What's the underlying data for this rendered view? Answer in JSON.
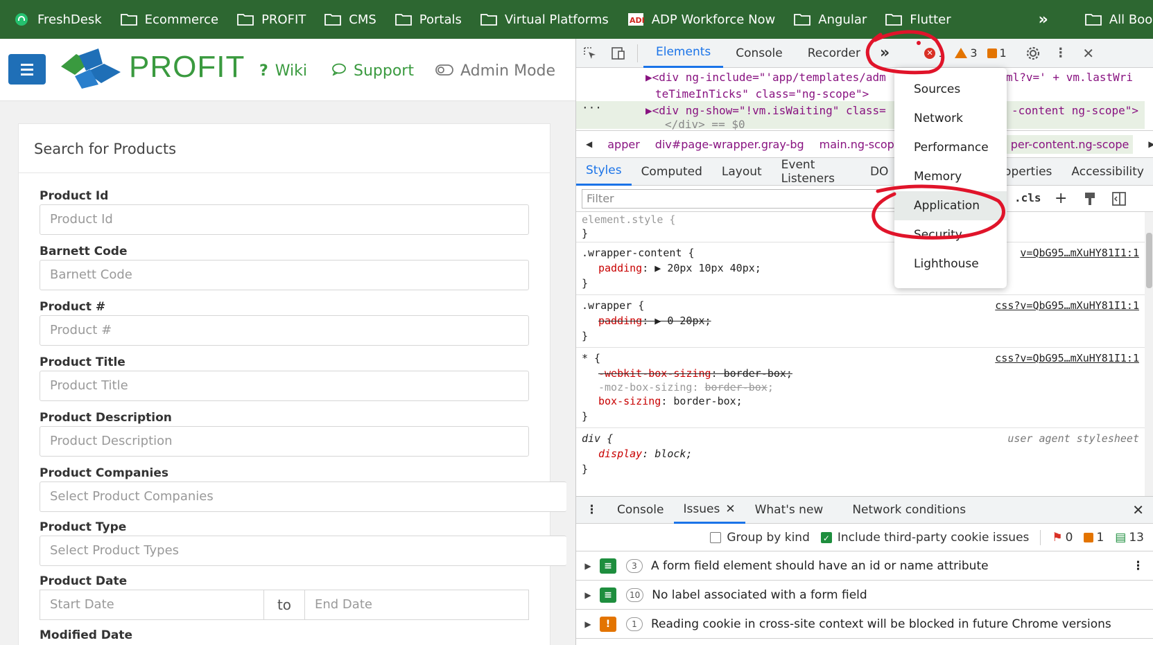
{
  "bookmarks": [
    {
      "label": "FreshDesk",
      "icon": "freshdesk-icon"
    },
    {
      "label": "Ecommerce",
      "icon": "folder-icon"
    },
    {
      "label": "PROFIT",
      "icon": "folder-icon"
    },
    {
      "label": "CMS",
      "icon": "folder-icon"
    },
    {
      "label": "Portals",
      "icon": "folder-icon"
    },
    {
      "label": "Virtual Platforms",
      "icon": "folder-icon"
    },
    {
      "label": "ADP Workforce Now",
      "icon": "adp-icon"
    },
    {
      "label": "Angular",
      "icon": "folder-icon"
    },
    {
      "label": "Flutter",
      "icon": "folder-icon"
    }
  ],
  "bookmarks_more": "»",
  "all_bookmarks": "All Bookmarks",
  "app": {
    "logo_text": "PROFIT",
    "nav": {
      "wiki": "Wiki",
      "support": "Support",
      "admin": "Admin Mode"
    },
    "brand_green": "#3a9a3f",
    "menu_blue": "#1f6fb7"
  },
  "search": {
    "title": "Search for Products",
    "fields": [
      {
        "label": "Product Id",
        "placeholder": "Product Id"
      },
      {
        "label": "Barnett Code",
        "placeholder": "Barnett Code"
      },
      {
        "label": "Product #",
        "placeholder": "Product #"
      },
      {
        "label": "Product Title",
        "placeholder": "Product Title"
      },
      {
        "label": "Product Description",
        "placeholder": "Product Description"
      },
      {
        "label": "Product Companies",
        "placeholder": "Select Product Companies"
      },
      {
        "label": "Product Type",
        "placeholder": "Select Product Types"
      }
    ],
    "date": {
      "label": "Product Date",
      "start": "Start Date",
      "to": "to",
      "end": "End Date"
    },
    "modified_label": "Modified Date"
  },
  "devtools": {
    "tabs": [
      "Elements",
      "Console",
      "Recorder"
    ],
    "active_tab": "Elements",
    "more_tabs": "»",
    "counts": {
      "errors": "1",
      "warnings": "3",
      "issues": "1"
    },
    "dom": {
      "line1a": "▶<div ng-include=\"'app/templates/adm",
      "line1b": "ml?v=' + vm.lastWri",
      "line2": "teTimeInTicks\" class=\"ng-scope\">",
      "line3a": "▶<div ng-show=\"!vm.isWaiting\" class=",
      "line3b": "-content ng-scope\">",
      "line4": "</div> == $0",
      "ellipsis": "···"
    },
    "breadcrumbs": [
      "apper",
      "div#page-wrapper.gray-bg",
      "main.ng-scope",
      "per-content.ng-scope"
    ],
    "sub_tabs": [
      "Styles",
      "Computed",
      "Layout",
      "Event Listeners",
      "DO",
      "roperties",
      "Accessibility"
    ],
    "filter_placeholder": "Filter",
    "cls": ".cls",
    "rules": {
      "element_style": "element.style {",
      "close": "}",
      "wc_selector": ".wrapper-content {",
      "wc_prop": "padding",
      "wc_value": "▶ 20px 10px 40px;",
      "wc_src": "v=QbG95…mXuHY81I1:1",
      "w_selector": ".wrapper {",
      "w_prop": "padding",
      "w_value": "▶ 0 20px;",
      "w_src": "css?v=QbG95…mXuHY81I1:1",
      "star_selector": "* {",
      "star_p1": "-webkit-box-sizing",
      "star_v1": "border-box;",
      "star_p2": "-moz-box-sizing:",
      "star_v2": "border-box",
      "star_p3": "box-sizing",
      "star_v3": "border-box;",
      "star_src": "css?v=QbG95…mXuHY81I1:1",
      "div_selector": "div {",
      "div_prop": "display",
      "div_value": "block;",
      "div_src": "user agent stylesheet"
    },
    "overflow_menu": [
      "Sources",
      "Network",
      "Performance",
      "Memory",
      "Application",
      "Security",
      "Lighthouse"
    ],
    "highlighted_menu_item": "Application",
    "drawer_tabs": [
      "Console",
      "Issues",
      "What's new",
      "Network conditions"
    ],
    "active_drawer_tab": "Issues",
    "group_by_kind": "Group by kind",
    "include_third_party": "Include third-party cookie issues",
    "issue_counts": {
      "errors": "0",
      "warnings": "1",
      "info": "13"
    },
    "issues": [
      {
        "count": "3",
        "text": "A form field element should have an id or name attribute",
        "kind": "info"
      },
      {
        "count": "10",
        "text": "No label associated with a form field",
        "kind": "info"
      },
      {
        "count": "1",
        "text": "Reading cookie in cross-site context will be blocked in future Chrome versions",
        "kind": "warning"
      }
    ]
  },
  "colors": {
    "bookmark_bar": "#2d6731",
    "annotation_red": "#e0142a",
    "accent_blue": "#1a73e8"
  }
}
